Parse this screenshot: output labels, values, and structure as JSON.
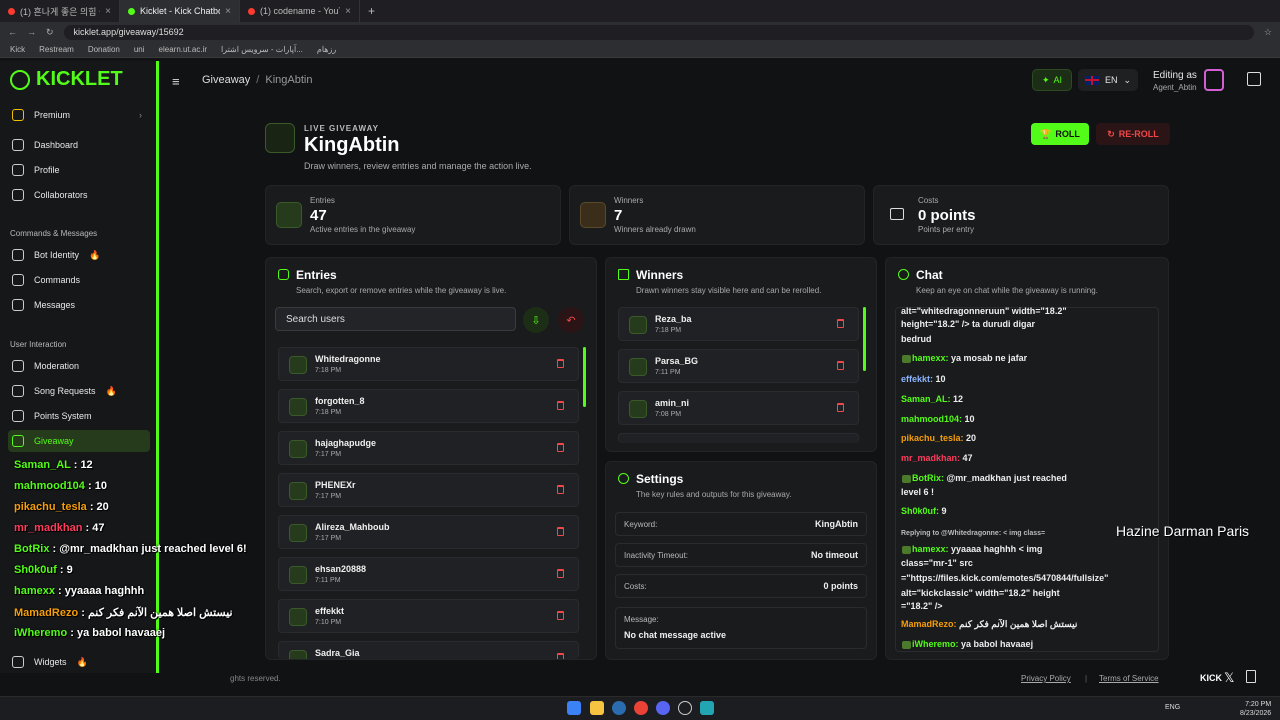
{
  "browser": {
    "tabs": [
      {
        "label": "(1) 흔나게 좋은 의힘 들어요"
      },
      {
        "label": "Kicklet - Kick Chatbot, Kick Wi..."
      },
      {
        "label": "(1) codename - YouTube"
      }
    ],
    "url": "kicklet.app/giveaway/15692",
    "bookmarks": [
      "Kick",
      "Restream",
      "Donation",
      "uni",
      "elearn.ut.ac.ir",
      "آپارات - سرویس اشترا...",
      "رزهام"
    ]
  },
  "sidebar": {
    "brand": "KICKLET",
    "premium": "Premium",
    "main": [
      "Dashboard",
      "Profile",
      "Collaborators"
    ],
    "section_commands": "Commands & Messages",
    "commands": [
      "Bot Identity",
      "Commands",
      "Messages"
    ],
    "section_interaction": "User Interaction",
    "interaction": [
      "Moderation",
      "Song Requests",
      "Points System",
      "Giveaway"
    ],
    "widgets": "Widgets"
  },
  "header": {
    "crumb_root": "Giveaway",
    "crumb_current": "KingAbtin",
    "ai_label": "AI",
    "lang": "EN",
    "editing_as": "Editing as",
    "editor_name": "Agent_Abtin"
  },
  "giveaway": {
    "live_label": "LIVE GIVEAWAY",
    "title": "KingAbtin",
    "subtitle": "Draw winners, review entries and manage the action live.",
    "roll": "ROLL",
    "reroll": "RE-ROLL"
  },
  "stats": {
    "entries": {
      "label": "Entries",
      "value": "47",
      "desc": "Active entries in the giveaway"
    },
    "winners": {
      "label": "Winners",
      "value": "7",
      "desc": "Winners already drawn"
    },
    "costs": {
      "label": "Costs",
      "value": "0 points",
      "desc": "Points per entry"
    }
  },
  "entries": {
    "title": "Entries",
    "desc": "Search, export or remove entries while the giveaway is live.",
    "search_placeholder": "Search users",
    "rows": [
      {
        "name": "Whitedragonne",
        "time": "7:18 PM"
      },
      {
        "name": "forgotten_8",
        "time": "7:18 PM"
      },
      {
        "name": "hajaghapudge",
        "time": "7:17 PM"
      },
      {
        "name": "PHENEXr",
        "time": "7:17 PM"
      },
      {
        "name": "Alireza_Mahboub",
        "time": "7:17 PM"
      },
      {
        "name": "ehsan20888",
        "time": "7:11 PM"
      },
      {
        "name": "effekkt",
        "time": "7:10 PM"
      },
      {
        "name": "Sadra_Gia",
        "time": ""
      }
    ]
  },
  "winners": {
    "title": "Winners",
    "desc": "Drawn winners stay visible here and can be rerolled.",
    "rows": [
      {
        "name": "Reza_ba",
        "time": "7:18 PM"
      },
      {
        "name": "Parsa_BG",
        "time": "7:11 PM"
      },
      {
        "name": "amin_ni",
        "time": "7:08 PM"
      }
    ]
  },
  "settings": {
    "title": "Settings",
    "desc": "The key rules and outputs for this giveaway.",
    "keyword_label": "Keyword:",
    "keyword": "KingAbtin",
    "timeout_label": "Inactivity Timeout:",
    "timeout": "No timeout",
    "costs_label": "Costs:",
    "costs": "0 points",
    "message_label": "Message:",
    "message": "No chat message active"
  },
  "chat": {
    "title": "Chat",
    "desc": "Keep an eye on chat while the giveaway is running.",
    "lines": [
      {
        "user": "",
        "text": "alt=\"whitedragonneruun\" width=\"18.2\""
      },
      {
        "user": "",
        "text": "height=\"18.2\" /> ta durudi digar"
      },
      {
        "user": "",
        "text": "bedrud"
      },
      {
        "user": "hamexx:",
        "text": "ya mosab ne jafar"
      },
      {
        "user": "effekkt:",
        "text": "10"
      },
      {
        "user": "Saman_AL:",
        "text": "12"
      },
      {
        "user": "mahmood104:",
        "text": "10"
      },
      {
        "user": "pikachu_tesla:",
        "text": "20"
      },
      {
        "user": "mr_madkhan:",
        "text": "47"
      },
      {
        "user": "BotRix:",
        "text": "@mr_madkhan just reached"
      },
      {
        "user": "",
        "text": "level 6 !"
      },
      {
        "user": "Sh0k0uf:",
        "text": "9"
      },
      {
        "user": "",
        "text": "Replying to @Whitedragonne: < img class="
      },
      {
        "user": "hamexx:",
        "text": "yyaaaa haghhh < img"
      },
      {
        "user": "",
        "text": "class=\"mr-1\" src"
      },
      {
        "user": "",
        "text": "=\"https://files.kick.com/emotes/5470844/fullsize\""
      },
      {
        "user": "",
        "text": "alt=\"kickclassic\" width=\"18.2\" height"
      },
      {
        "user": "",
        "text": "=\"18.2\" />"
      },
      {
        "user": "MamadRezo:",
        "text": "نیستش اصلا همین الآنم فکر کنم"
      },
      {
        "user": "iWheremo:",
        "text": "ya babol havaaej"
      }
    ]
  },
  "overlay": {
    "lines": [
      {
        "user": "Saman_AL",
        "text": ": 12"
      },
      {
        "user": "mahmood104",
        "text": ": 10"
      },
      {
        "user": "pikachu_tesla",
        "text": ": 20"
      },
      {
        "user": "mr_madkhan",
        "text": ": 47"
      },
      {
        "user": "BotRix",
        "text": ": @mr_madkhan just reached level 6!"
      },
      {
        "user": "Sh0k0uf",
        "text": ": 9"
      },
      {
        "user": "hamexx",
        "text": ": yyaaaa haghhh"
      },
      {
        "user": "MamadRezo",
        "text": ": نیستش اصلا همین الآنم فکر کنم"
      },
      {
        "user": "iWheremo",
        "text": ": ya babol havaaej"
      }
    ],
    "watermark": "Hazine Darman Paris"
  },
  "footer": {
    "rights": "ghts reserved.",
    "privacy": "Privacy Policy",
    "terms": "Terms of Service",
    "kick": "KICK"
  },
  "taskbar": {
    "lang": "ENG",
    "time": "7:20 PM",
    "date": "8/23/2026"
  }
}
